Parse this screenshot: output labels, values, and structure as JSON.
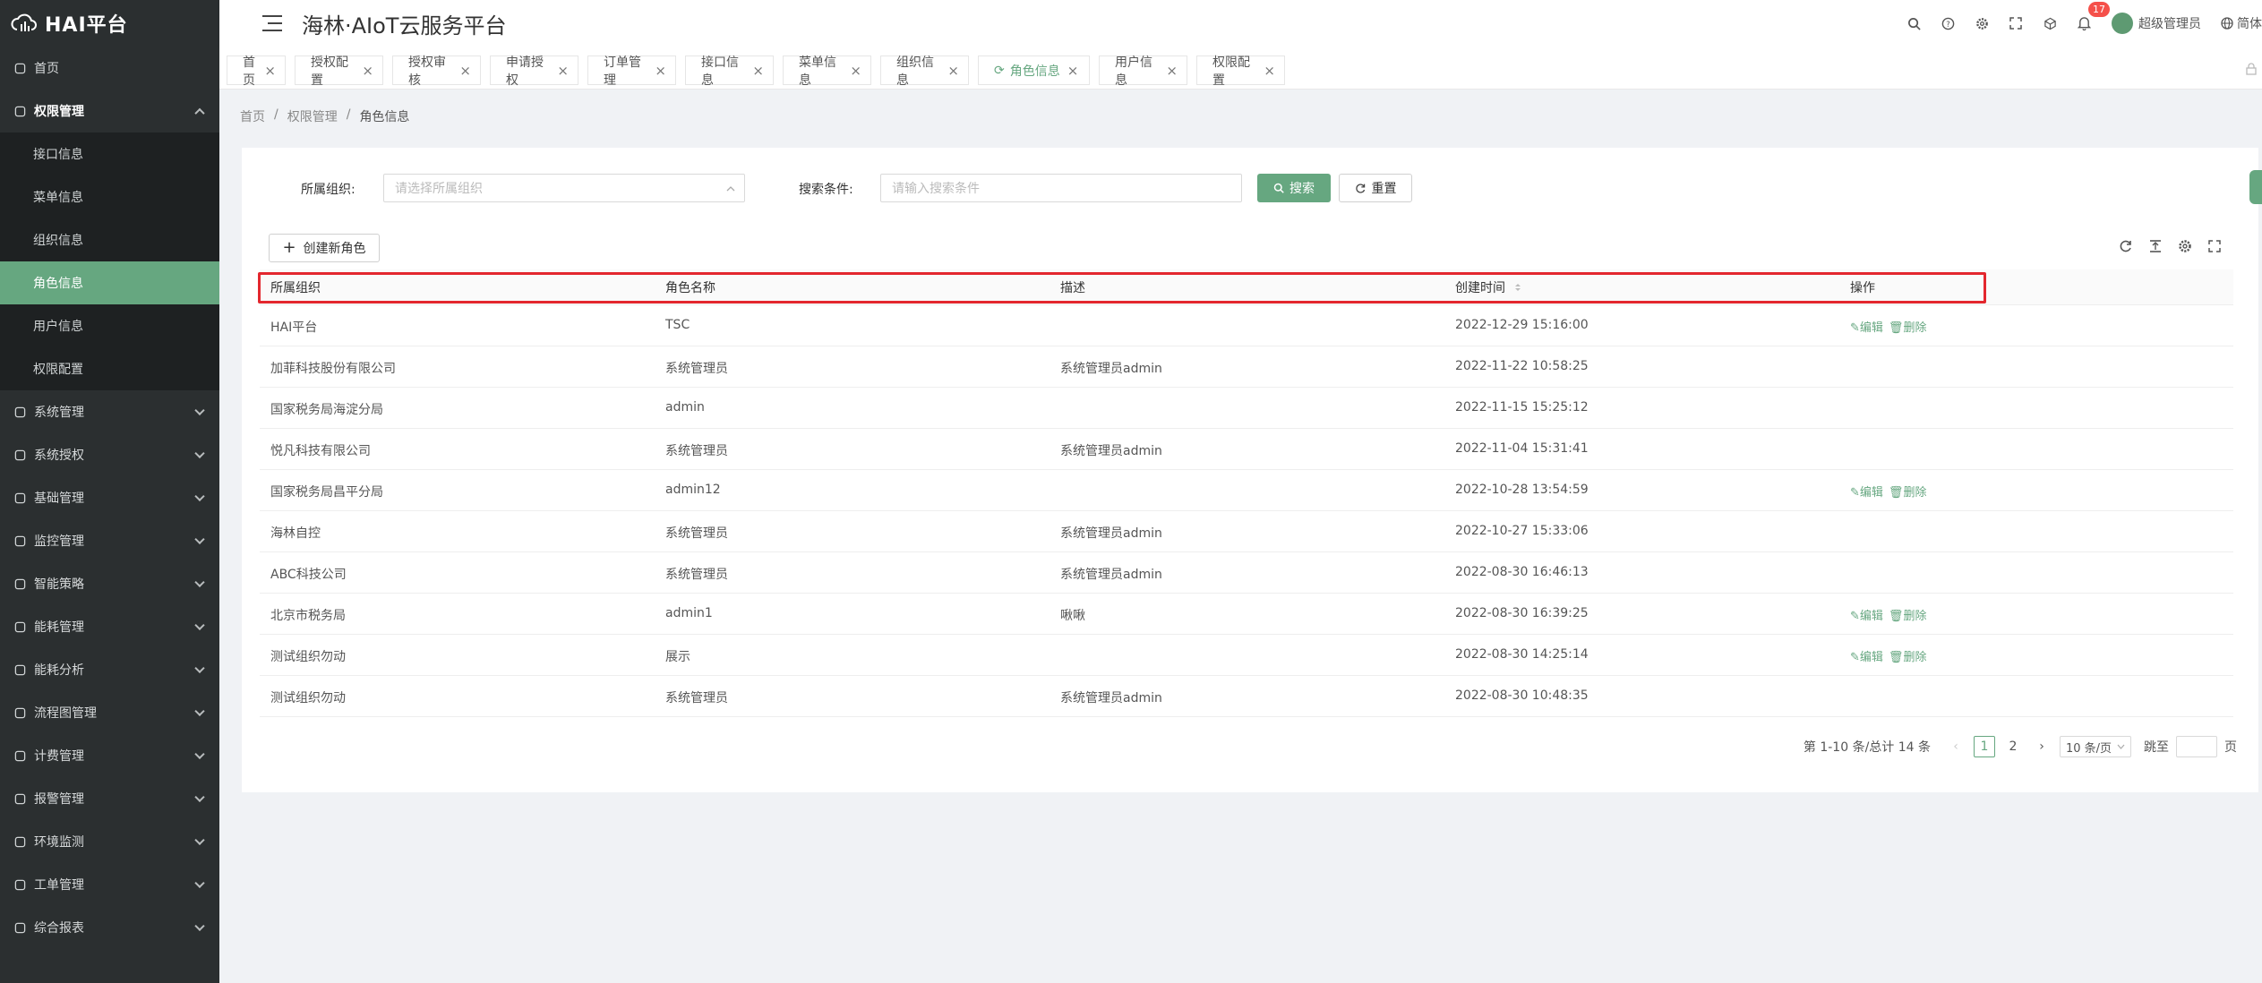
{
  "app": {
    "logo_text": "HAI平台",
    "title": "海林·AIoT云服务平台"
  },
  "header": {
    "notifications_count": "17",
    "user_name": "超级管理员",
    "language": "简体"
  },
  "sidebar": {
    "items": [
      {
        "label": "首页",
        "icon": "home-icon"
      },
      {
        "label": "权限管理",
        "icon": "shield-icon",
        "open": true,
        "children": [
          "接口信息",
          "菜单信息",
          "组织信息",
          "角色信息",
          "用户信息",
          "权限配置"
        ]
      },
      {
        "label": "系统管理",
        "icon": "monitor-icon"
      },
      {
        "label": "系统授权",
        "icon": "monitor-icon"
      },
      {
        "label": "基础管理",
        "icon": "grid-icon"
      },
      {
        "label": "监控管理",
        "icon": "camera-icon"
      },
      {
        "label": "智能策略",
        "icon": "bulb-icon"
      },
      {
        "label": "能耗管理",
        "icon": "sliders-icon"
      },
      {
        "label": "能耗分析",
        "icon": "chart-icon"
      },
      {
        "label": "流程图管理",
        "icon": "flow-icon"
      },
      {
        "label": "计费管理",
        "icon": "clock-icon"
      },
      {
        "label": "报警管理",
        "icon": "alarm-icon"
      },
      {
        "label": "环境监测",
        "icon": "leaf-icon"
      },
      {
        "label": "工单管理",
        "icon": "layers-icon"
      },
      {
        "label": "综合报表",
        "icon": "report-icon"
      }
    ],
    "active_child": "角色信息"
  },
  "tabs": [
    "首页",
    "授权配置",
    "授权审核",
    "申请授权",
    "订单管理",
    "接口信息",
    "菜单信息",
    "组织信息",
    "角色信息",
    "用户信息",
    "权限配置"
  ],
  "active_tab": "角色信息",
  "breadcrumb": {
    "sep": "/",
    "items": [
      "首页",
      "权限管理",
      "角色信息"
    ]
  },
  "search_form": {
    "org_label": "所属组织:",
    "org_placeholder": "请选择所属组织",
    "cond_label": "搜索条件:",
    "cond_placeholder": "请输入搜索条件",
    "search_btn": "搜索",
    "reset_btn": "重置"
  },
  "create_btn": "创建新角色",
  "table": {
    "columns": [
      "所属组织",
      "角色名称",
      "描述",
      "创建时间",
      "操作"
    ],
    "edit_label": "编辑",
    "delete_label": "删除",
    "rows": [
      {
        "org": "HAI平台",
        "name": "TSC",
        "desc": "",
        "time": "2022-12-29 15:16:00",
        "ops": true
      },
      {
        "org": "加菲科技股份有限公司",
        "name": "系统管理员",
        "desc": "系统管理员admin",
        "time": "2022-11-22 10:58:25",
        "ops": false
      },
      {
        "org": "国家税务局海淀分局",
        "name": "admin",
        "desc": "",
        "time": "2022-11-15 15:25:12",
        "ops": false
      },
      {
        "org": "悦凡科技有限公司",
        "name": "系统管理员",
        "desc": "系统管理员admin",
        "time": "2022-11-04 15:31:41",
        "ops": false
      },
      {
        "org": "国家税务局昌平分局",
        "name": "admin12",
        "desc": "",
        "time": "2022-10-28 13:54:59",
        "ops": true
      },
      {
        "org": "海林自控",
        "name": "系统管理员",
        "desc": "系统管理员admin",
        "time": "2022-10-27 15:33:06",
        "ops": false
      },
      {
        "org": "ABC科技公司",
        "name": "系统管理员",
        "desc": "系统管理员admin",
        "time": "2022-08-30 16:46:13",
        "ops": false
      },
      {
        "org": "北京市税务局",
        "name": "admin1",
        "desc": "啾啾",
        "time": "2022-08-30 16:39:25",
        "ops": true
      },
      {
        "org": "测试组织勿动",
        "name": "展示",
        "desc": "",
        "time": "2022-08-30 14:25:14",
        "ops": true
      },
      {
        "org": "测试组织勿动",
        "name": "系统管理员",
        "desc": "系统管理员admin",
        "time": "2022-08-30 10:48:35",
        "ops": false
      }
    ]
  },
  "pagination": {
    "summary": "第 1-10 条/总计 14 条",
    "pages": [
      "1",
      "2"
    ],
    "current": "1",
    "page_size": "10 条/页",
    "jump_label": "跳至",
    "page_suffix": "页"
  },
  "colors": {
    "accent": "#66a780",
    "sidebar_bg": "#2b2f30",
    "highlight": "#e3272e",
    "badge": "#f5504a"
  }
}
